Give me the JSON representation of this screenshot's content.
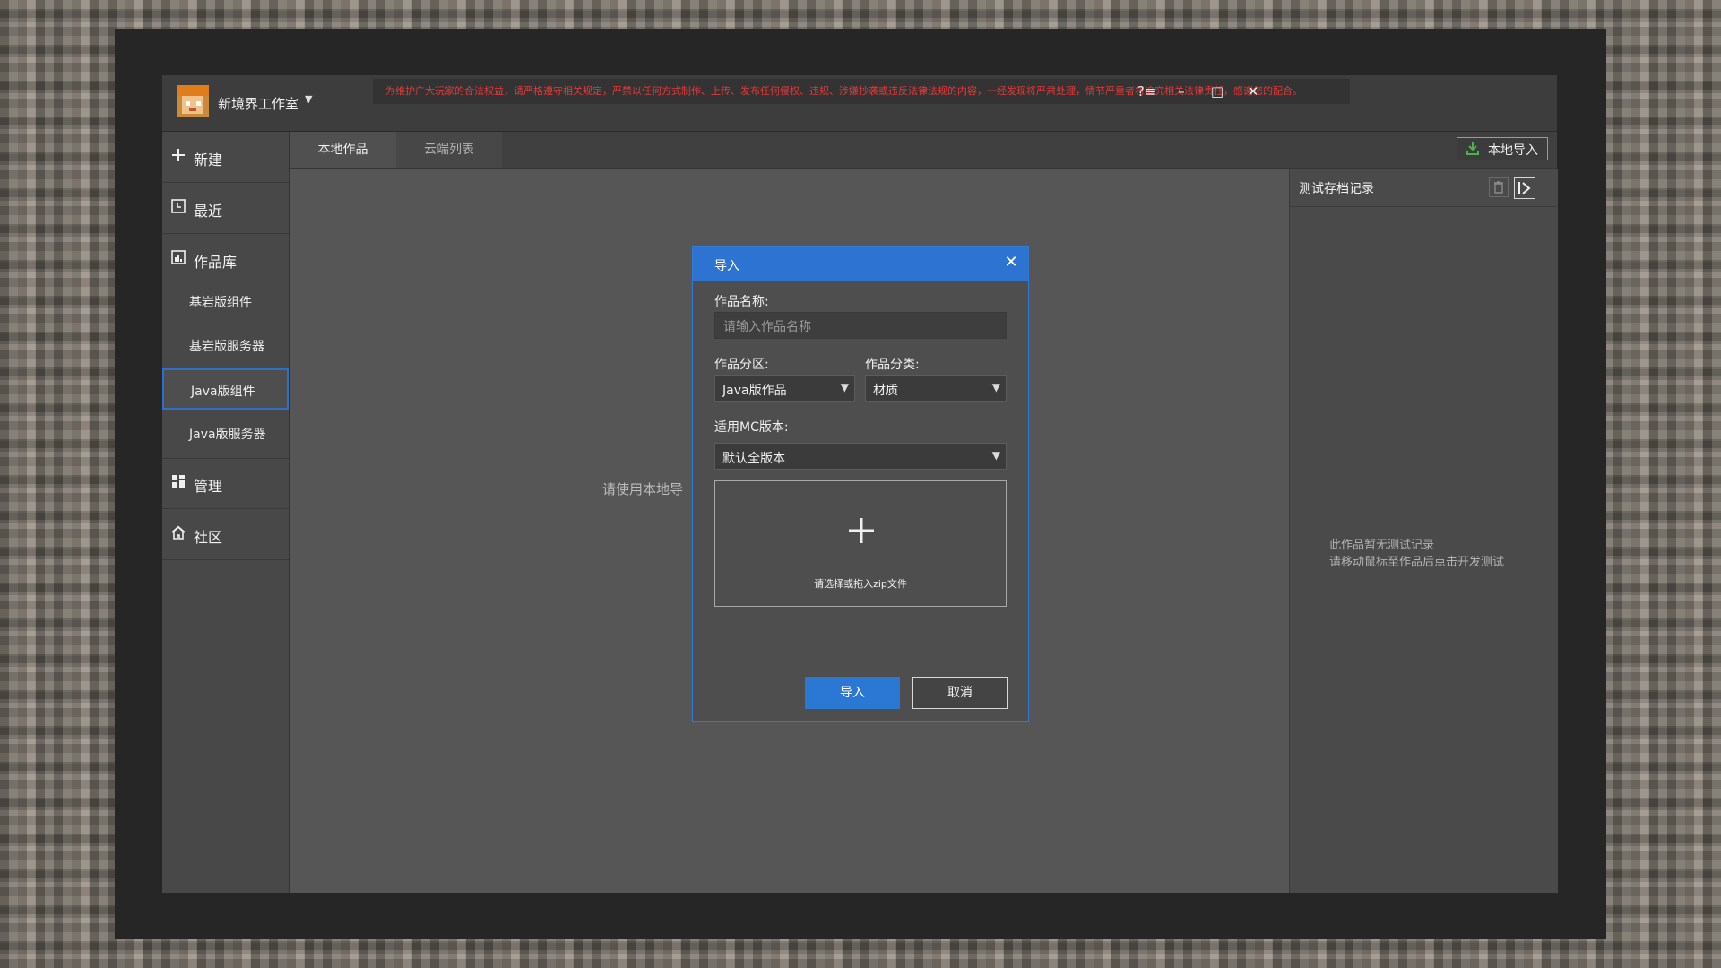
{
  "titlebar": {
    "studio_name": "新境界工作室",
    "notice": "为维护广大玩家的合法权益，请严格遵守相关规定，严禁以任何方式制作、上传、发布任何侵权、违规、涉嫌抄袭或违反法律法规的内容，一经发现将严肃处理，情节严重者将追究相关法律责任，感谢您的配合。",
    "help_icon": "?≡",
    "minimize_icon": "–",
    "maximize_icon": "□",
    "close_icon": "✕"
  },
  "sidebar": {
    "new_label": "新建",
    "recent_label": "最近",
    "library_label": "作品库",
    "sub_items": [
      "基岩版组件",
      "基岩版服务器",
      "Java版组件",
      "Java版服务器"
    ],
    "manage_label": "管理",
    "community_label": "社区"
  },
  "tabs": {
    "local": "本地作品",
    "cloud": "云端列表"
  },
  "header": {
    "import_label": "本地导入"
  },
  "main": {
    "hint": "请使用本地导"
  },
  "right_panel": {
    "title": "测试存档记录",
    "empty_line1": "此作品暂无测试记录",
    "empty_line2": "请移动鼠标至作品后点击开发测试"
  },
  "dialog": {
    "title": "导入",
    "name_label": "作品名称:",
    "name_placeholder": "请输入作品名称",
    "zone_label": "作品分区:",
    "zone_value": "Java版作品",
    "category_label": "作品分类:",
    "category_value": "材质",
    "version_label": "适用MC版本:",
    "version_value": "默认全版本",
    "dropzone_text": "请选择或拖入zip文件",
    "confirm_label": "导入",
    "cancel_label": "取消"
  },
  "colors": {
    "accent": "#2c73d2",
    "notice_text": "#e23a3a",
    "active_border": "#2f6fc9"
  }
}
